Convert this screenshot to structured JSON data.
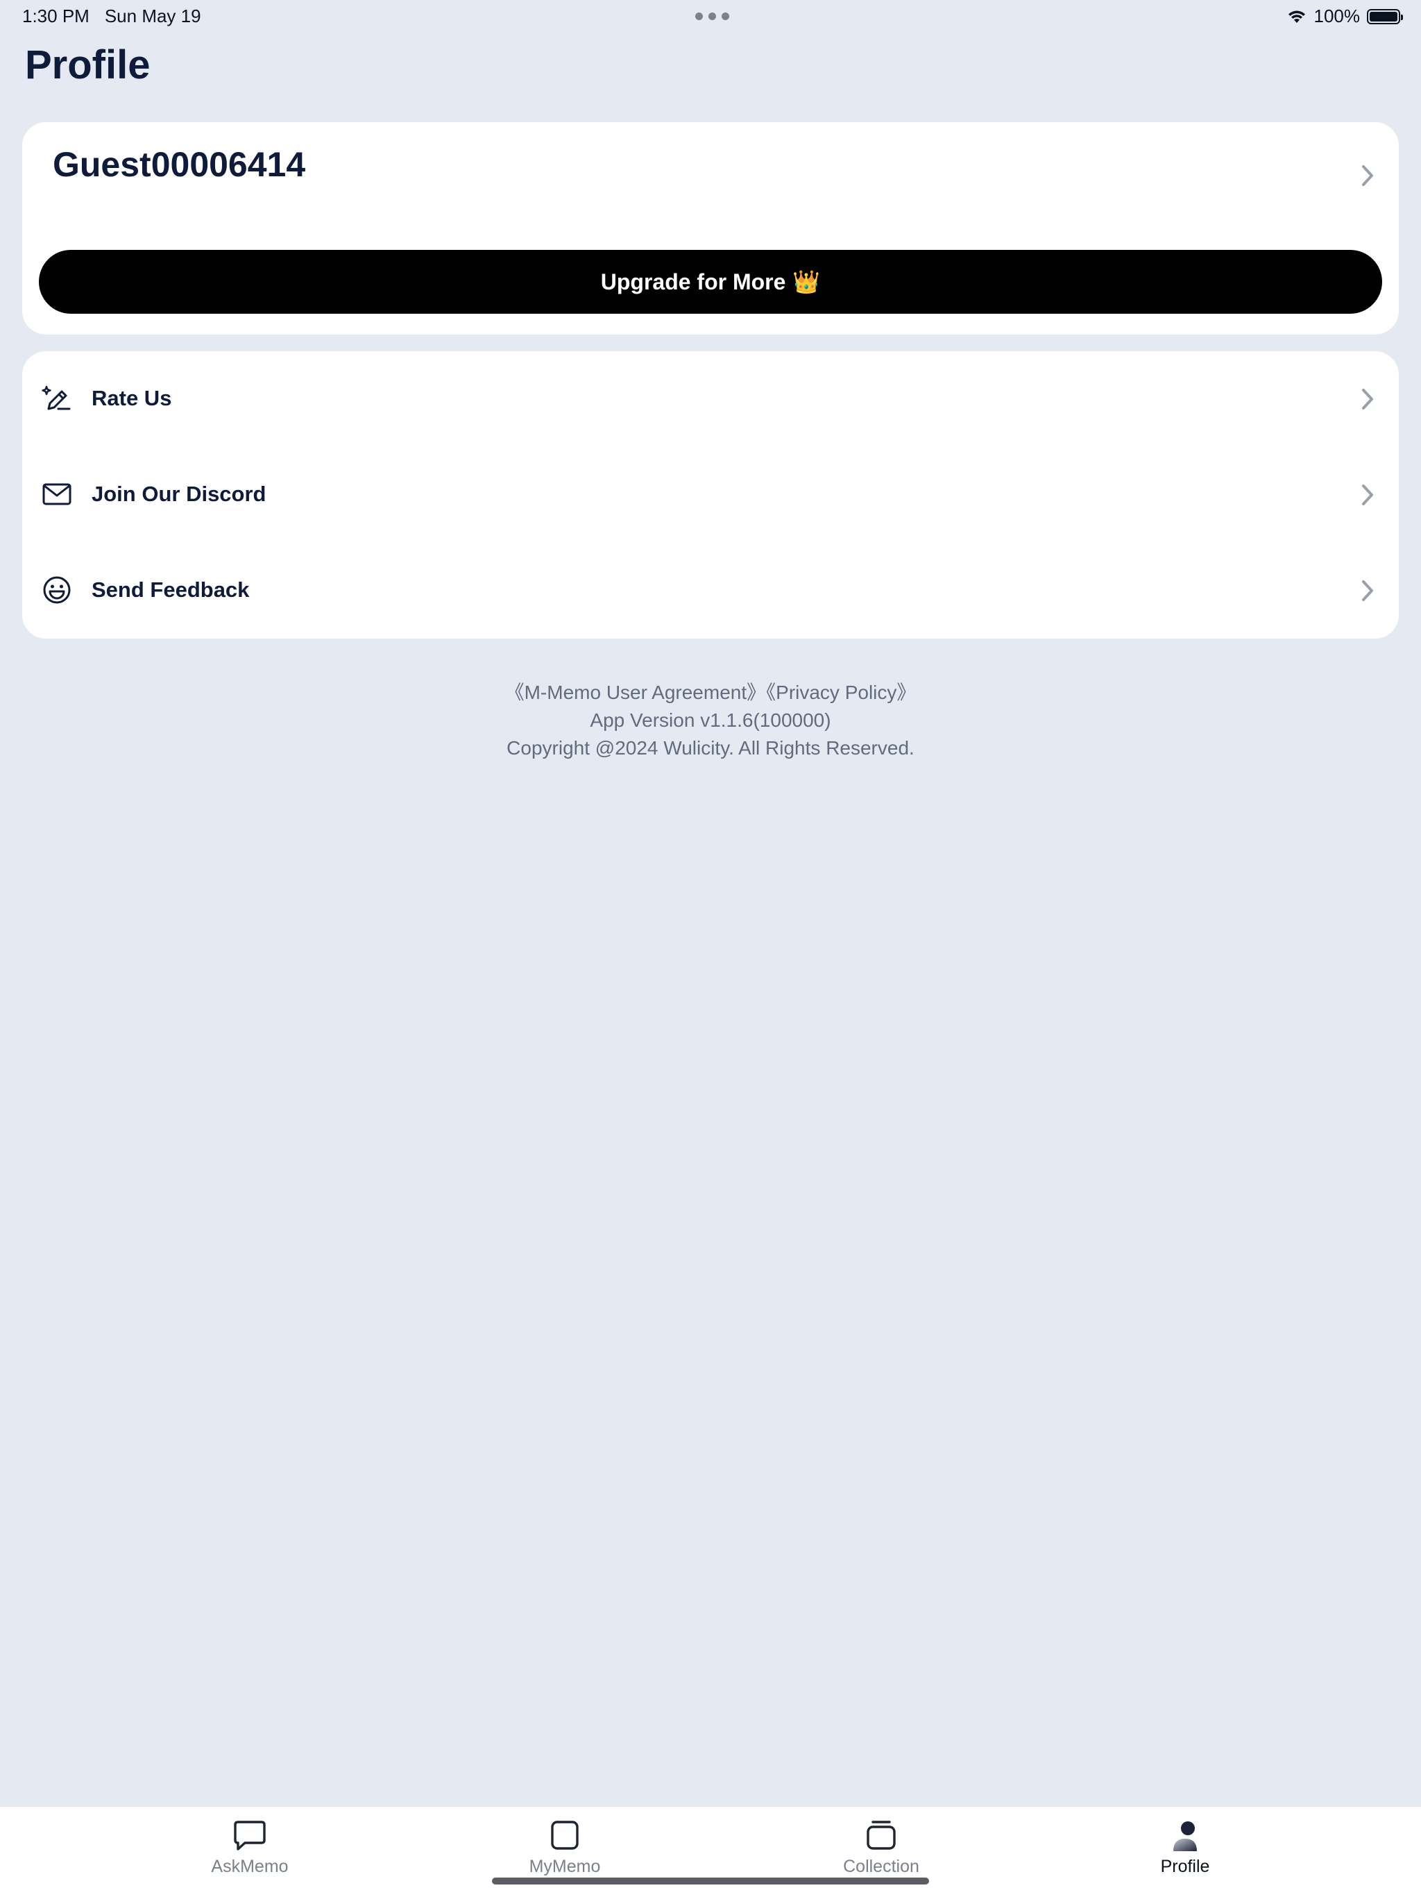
{
  "status_bar": {
    "time": "1:30 PM",
    "date": "Sun May 19",
    "battery": "100%",
    "battery_level": 1.0
  },
  "header": {
    "title": "Profile"
  },
  "account": {
    "username": "Guest00006414",
    "upgrade_label": "Upgrade for More",
    "upgrade_emoji": "👑"
  },
  "menu": {
    "items": [
      {
        "label": "Rate Us",
        "icon": "magic-pen-icon"
      },
      {
        "label": "Join Our Discord",
        "icon": "mail-icon"
      },
      {
        "label": "Send Feedback",
        "icon": "smiley-icon"
      }
    ]
  },
  "footer": {
    "agreement": "《M-Memo User Agreement》",
    "privacy": "《Privacy Policy》",
    "version": "App Version v1.1.6(100000)",
    "copyright": "Copyright @2024 Wulicity. All Rights Reserved."
  },
  "tabs": [
    {
      "label": "AskMemo",
      "icon": "chat-bubble-icon"
    },
    {
      "label": "MyMemo",
      "icon": "rounded-square-icon"
    },
    {
      "label": "Collection",
      "icon": "stack-icon"
    },
    {
      "label": "Profile",
      "icon": "person-icon",
      "active": true
    }
  ],
  "colors": {
    "background": "#e5e9f1",
    "card": "#ffffff",
    "primary_text": "#0f1b3a",
    "secondary_text": "#626b7d",
    "upgrade_button": "#000000",
    "tab_inactive": "#7a808c"
  }
}
